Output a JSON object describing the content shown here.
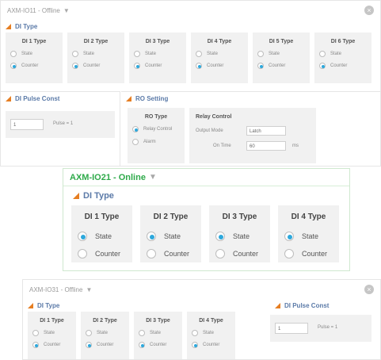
{
  "win1": {
    "title": "AXM-IO11 - Offline",
    "close": "×",
    "di_type_header": "DI Type",
    "di": [
      {
        "title": "DI 1 Type",
        "state": "State",
        "counter": "Counter"
      },
      {
        "title": "DI 2 Type",
        "state": "State",
        "counter": "Counter"
      },
      {
        "title": "DI 3 Type",
        "state": "State",
        "counter": "Counter"
      },
      {
        "title": "DI 4 Type",
        "state": "State",
        "counter": "Counter"
      },
      {
        "title": "DI 5 Type",
        "state": "State",
        "counter": "Counter"
      },
      {
        "title": "DI 6 Type",
        "state": "State",
        "counter": "Counter"
      }
    ],
    "pulse_header": "DI Pulse Const",
    "pulse_value": "1",
    "pulse_unit": "Pulse = 1",
    "ro_header": "RO Setting",
    "ro_type_title": "RO Type",
    "ro_relay": "Relay Control",
    "ro_alarm": "Alarm",
    "relay_ctrl_title": "Relay Control",
    "output_mode_label": "Output Mode",
    "output_mode_value": "Latch",
    "on_time_label": "On Time",
    "on_time_value": "60",
    "on_time_unit": "ms"
  },
  "win2": {
    "title": "AXM-IO21 - Online",
    "di_type_header": "DI Type",
    "di": [
      {
        "title": "DI 1 Type",
        "state": "State",
        "counter": "Counter"
      },
      {
        "title": "DI 2 Type",
        "state": "State",
        "counter": "Counter"
      },
      {
        "title": "DI 3 Type",
        "state": "State",
        "counter": "Counter"
      },
      {
        "title": "DI 4 Type",
        "state": "State",
        "counter": "Counter"
      }
    ]
  },
  "win3": {
    "title": "AXM-IO31 - Offline",
    "close": "×",
    "di_type_header": "DI Type",
    "di": [
      {
        "title": "DI 1 Type",
        "state": "State",
        "counter": "Counter"
      },
      {
        "title": "DI 2 Type",
        "state": "State",
        "counter": "Counter"
      },
      {
        "title": "DI 3 Type",
        "state": "State",
        "counter": "Counter"
      },
      {
        "title": "DI 4 Type",
        "state": "State",
        "counter": "Counter"
      }
    ],
    "pulse_header": "DI Pulse Const",
    "pulse_value": "1",
    "pulse_unit": "Pulse = 1"
  },
  "caret_glyph": "▼"
}
